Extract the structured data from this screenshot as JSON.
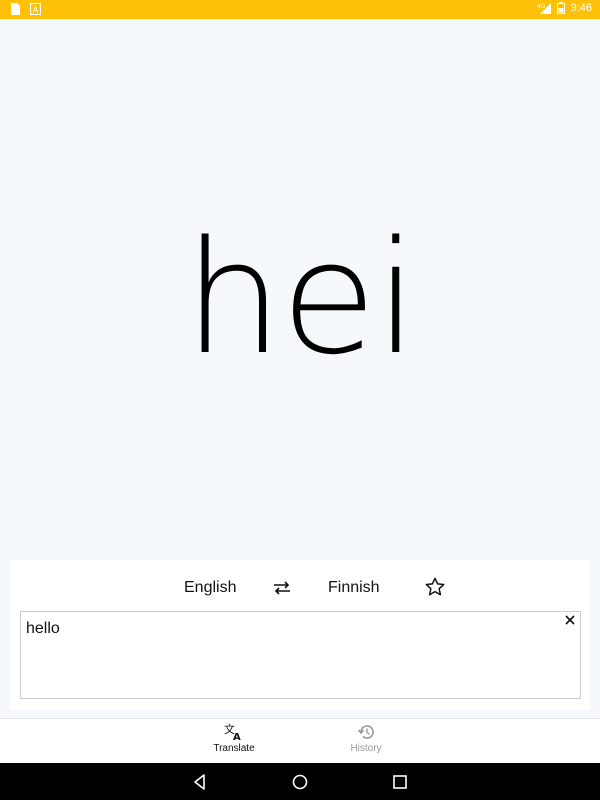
{
  "status_bar": {
    "left_icons": [
      "sim-card-icon",
      "app-a-icon"
    ],
    "network": "4G",
    "time": "9:46"
  },
  "result": {
    "text": "hei"
  },
  "languages": {
    "from": "English",
    "to": "Finnish",
    "swap_icon": "swap-icon",
    "favorite_icon": "star-outline-icon"
  },
  "input": {
    "value": "hello",
    "clear_icon": "close-icon"
  },
  "bottom_nav": {
    "items": [
      {
        "label": "Translate",
        "icon": "translate-icon",
        "active": true
      },
      {
        "label": "History",
        "icon": "history-icon",
        "active": false
      }
    ]
  },
  "colors": {
    "status_bar": "#ffc107",
    "background": "#f5f9fc",
    "active": "#111111",
    "inactive": "#9a9a9a"
  }
}
